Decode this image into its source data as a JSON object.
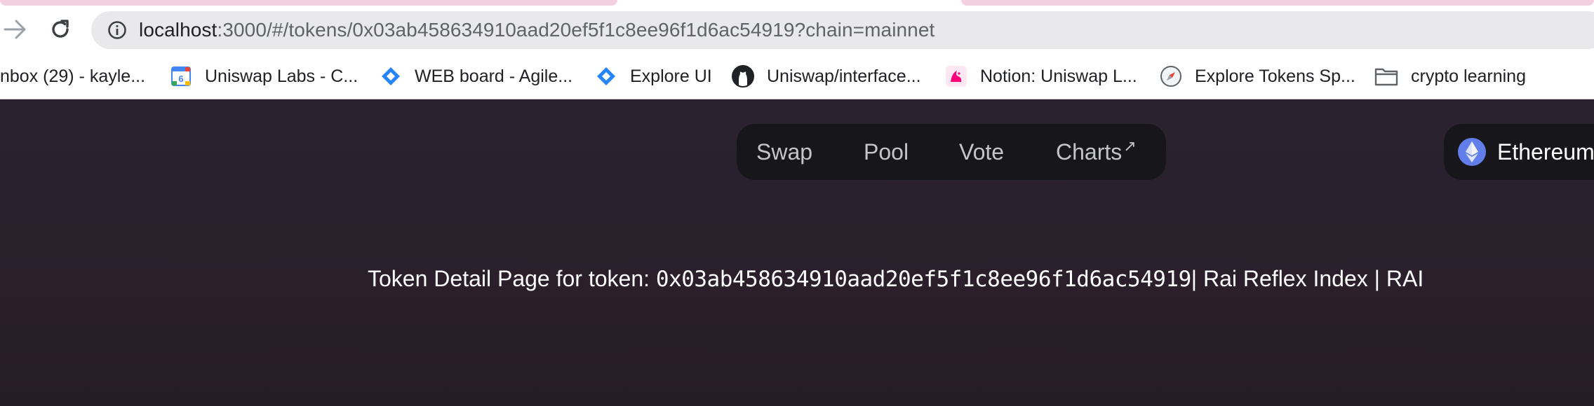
{
  "browser": {
    "url_host": "localhost",
    "url_rest": ":3000/#/tokens/0x03ab458634910aad20ef5f1c8ee96f1d6ac54919?chain=mainnet"
  },
  "bookmarks": [
    {
      "label": "nbox (29) - kayle...",
      "icon": "mail-icon"
    },
    {
      "label": "Uniswap Labs - C...",
      "icon": "calendar-icon"
    },
    {
      "label": "WEB board - Agile...",
      "icon": "jira-icon"
    },
    {
      "label": "Explore UI",
      "icon": "jira-icon"
    },
    {
      "label": "Uniswap/interface...",
      "icon": "github-icon"
    },
    {
      "label": "Notion: Uniswap L...",
      "icon": "uniswap-icon"
    },
    {
      "label": "Explore Tokens Sp...",
      "icon": "compass-icon"
    },
    {
      "label": "crypto learning",
      "icon": "folder-icon"
    }
  ],
  "nav": {
    "items": [
      "Swap",
      "Pool",
      "Vote",
      "Charts"
    ],
    "charts_arrow": "↗"
  },
  "chain": {
    "label": "Ethereum"
  },
  "detail": {
    "prefix": "Token Detail Page for token: ",
    "address": "0x03ab458634910aad20ef5f1c8ee96f1d6ac54919",
    "suffix": "| Rai Reflex Index | RAI"
  },
  "colors": {
    "page_bg": "#2a1f2c",
    "pill_bg": "#17161b",
    "ethereum_blue": "#627eea",
    "tab_highlight": "#f3cfe0"
  }
}
